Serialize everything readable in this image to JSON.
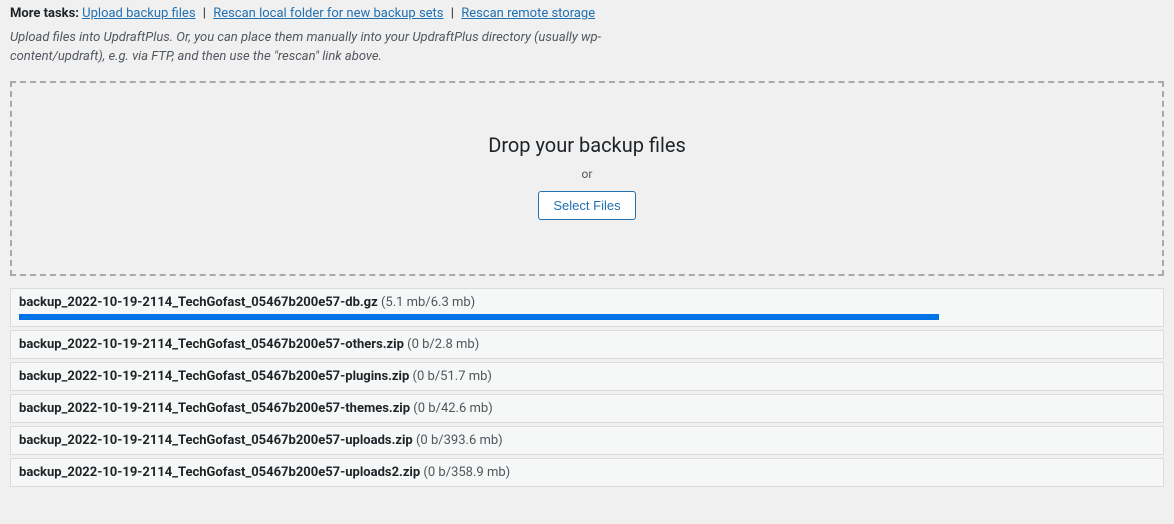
{
  "moreTasks": {
    "label": "More tasks:",
    "links": [
      "Upload backup files",
      "Rescan local folder for new backup sets",
      "Rescan remote storage"
    ],
    "separator": "|"
  },
  "helpText": "Upload files into UpdraftPlus. Or, you can place them manually into your UpdraftPlus directory (usually wp-content/updraft), e.g. via FTP, and then use the \"rescan\" link above.",
  "dropzone": {
    "title": "Drop your backup files",
    "or": "or",
    "button": "Select Files"
  },
  "uploads": [
    {
      "name": "backup_2022-10-19-2114_TechGofast_05467b200e57-db.gz",
      "size": "(5.1 mb/6.3 mb)",
      "progressPct": 81
    },
    {
      "name": "backup_2022-10-19-2114_TechGofast_05467b200e57-others.zip",
      "size": "(0 b/2.8 mb)",
      "progressPct": 0
    },
    {
      "name": "backup_2022-10-19-2114_TechGofast_05467b200e57-plugins.zip",
      "size": "(0 b/51.7 mb)",
      "progressPct": 0
    },
    {
      "name": "backup_2022-10-19-2114_TechGofast_05467b200e57-themes.zip",
      "size": "(0 b/42.6 mb)",
      "progressPct": 0
    },
    {
      "name": "backup_2022-10-19-2114_TechGofast_05467b200e57-uploads.zip",
      "size": "(0 b/393.6 mb)",
      "progressPct": 0
    },
    {
      "name": "backup_2022-10-19-2114_TechGofast_05467b200e57-uploads2.zip",
      "size": "(0 b/358.9 mb)",
      "progressPct": 0
    }
  ]
}
